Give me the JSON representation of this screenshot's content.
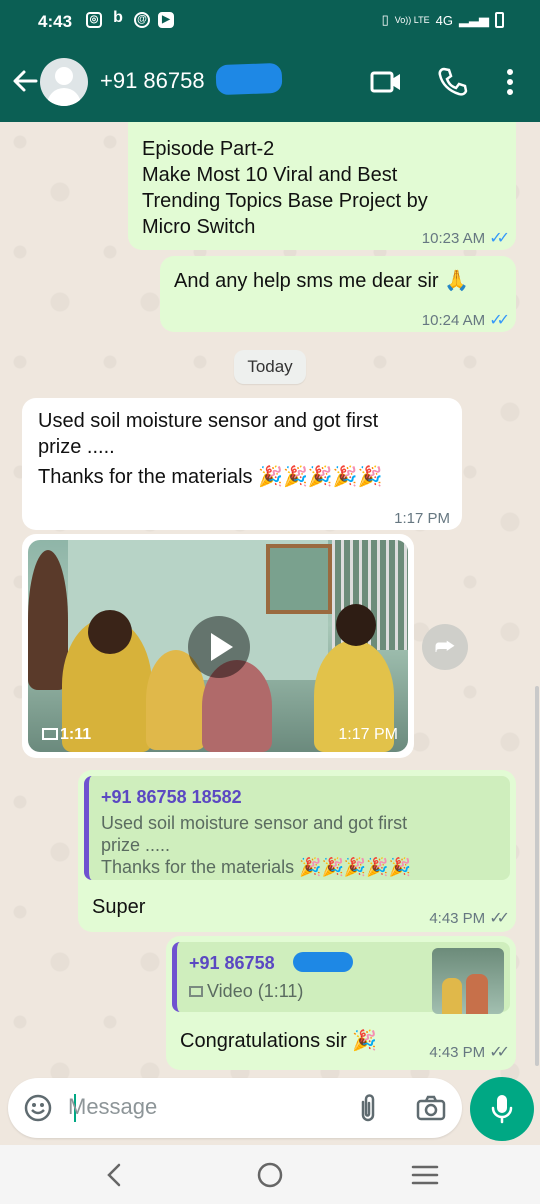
{
  "status_bar": {
    "time": "4:43",
    "network": "4G",
    "volte": "Vo)) LTE"
  },
  "header": {
    "contact_name": "+91 86758",
    "icons": [
      "back-arrow-icon",
      "video-call-icon",
      "voice-call-icon",
      "more-options-icon"
    ]
  },
  "messages": {
    "m1": {
      "text_lines": [
        "Episode Part-2",
        "Make Most 10 Viral and Best",
        "Trending Topics Base Project by",
        "Micro Switch"
      ],
      "time": "10:23 AM"
    },
    "m2": {
      "text": "And any help sms me dear sir 🙏",
      "time": "10:24 AM"
    },
    "day_divider": "Today",
    "m3": {
      "line1": "Used soil moisture sensor and got first",
      "line2": "prize .....",
      "line3": "Thanks for the materials 🎉🎉🎉🎉🎉",
      "time": "1:17 PM"
    },
    "m4_video": {
      "duration": "1:11",
      "time": "1:17 PM"
    },
    "m5": {
      "quote_name": "+91 86758 18582",
      "quote_line1": "Used soil moisture sensor and got first",
      "quote_line2": "prize .....",
      "quote_line3": "Thanks for the materials 🎉🎉🎉🎉🎉",
      "text": "Super",
      "time": "4:43 PM"
    },
    "m6": {
      "quote_name": "+91 86758",
      "quote_media": "Video (1:11)",
      "text": "Congratulations sir 🎉",
      "time": "4:43 PM"
    }
  },
  "composer": {
    "placeholder": "Message",
    "icons": [
      "emoji-icon",
      "attach-icon",
      "camera-icon",
      "mic-icon"
    ]
  },
  "colors": {
    "header": "#0b5f54",
    "outgoing_bubble": "#e2fbd4",
    "incoming_bubble": "#ffffff",
    "read_tick": "#3497f9",
    "accent": "#00a884",
    "quote_bar": "#6f52d0"
  }
}
